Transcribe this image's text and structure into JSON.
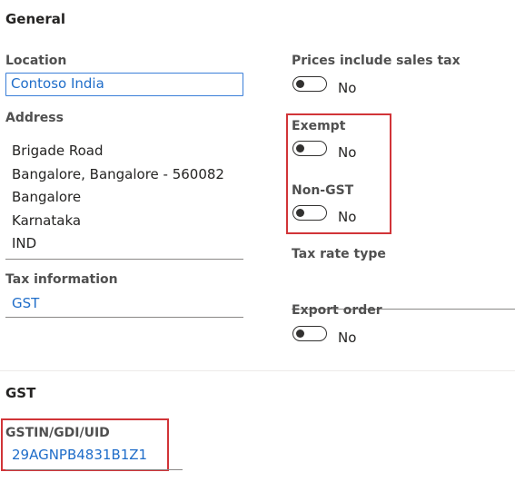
{
  "general": {
    "title": "General",
    "location": {
      "label": "Location",
      "value": "Contoso India"
    },
    "address": {
      "label": "Address",
      "lines": [
        "Brigade Road",
        "Bangalore, Bangalore - 560082",
        "Bangalore",
        "Karnataka",
        "IND"
      ]
    },
    "tax_information": {
      "label": "Tax information",
      "value": "GST"
    },
    "prices_include_sales_tax": {
      "label": "Prices include sales tax",
      "state": "No"
    },
    "exempt": {
      "label": "Exempt",
      "state": "No"
    },
    "non_gst": {
      "label": "Non-GST",
      "state": "No"
    },
    "tax_rate_type": {
      "label": "Tax rate type",
      "value": ""
    },
    "export_order": {
      "label": "Export order",
      "state": "No"
    }
  },
  "gst": {
    "title": "GST",
    "gstin": {
      "label": "GSTIN/GDI/UID",
      "value": "29AGNPB4831B1Z1"
    }
  },
  "colors": {
    "highlight_border": "#d13438",
    "link": "#1f6dc9"
  }
}
